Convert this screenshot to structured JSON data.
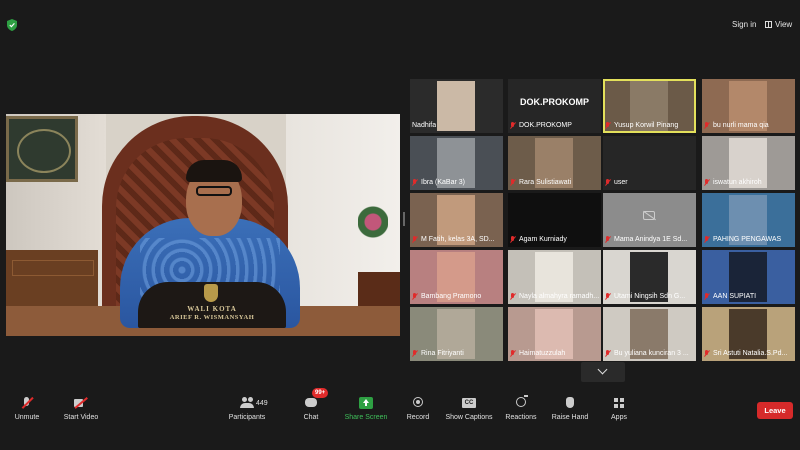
{
  "top": {
    "sign_in": "Sign in",
    "view": "View"
  },
  "speaker": {
    "nameplate_line1": "WALI KOTA",
    "nameplate_line2": "ARIEF R. WISMANSYAH"
  },
  "gallery": [
    {
      "label": "Nadhifa",
      "muted": false,
      "active": false,
      "bg": "#2b2b2b",
      "thumb": "#cbb9a6"
    },
    {
      "label": "DOK.PROKOMP",
      "muted": true,
      "active": false,
      "bg": "#262626",
      "title": "DOK.PROKOMP"
    },
    {
      "label": "Yusup Korwil Pinang",
      "muted": true,
      "active": true,
      "bg": "#6b5a48",
      "thumb": "#8a7a66"
    },
    {
      "label": "bu nurli mama qia",
      "muted": true,
      "active": false,
      "bg": "#8e6a52",
      "thumb": "#b3886a"
    },
    {
      "label": "Ibra (KaBar 3)",
      "muted": true,
      "active": false,
      "bg": "#4a4f55",
      "thumb": "#8e9296"
    },
    {
      "label": "Rara Sulistiawati",
      "muted": true,
      "active": false,
      "bg": "#6d5c4a",
      "thumb": "#9a8068"
    },
    {
      "label": "user",
      "muted": true,
      "active": false,
      "bg": "#262626"
    },
    {
      "label": "iswatun akhiroh",
      "muted": true,
      "active": false,
      "bg": "#9e9a96",
      "thumb": "#d8d2cc"
    },
    {
      "label": "M Fatih, kelas 3A, SD...",
      "muted": true,
      "active": false,
      "bg": "#7a6250",
      "thumb": "#c19a7c"
    },
    {
      "label": "Agam Kurniady",
      "muted": true,
      "active": false,
      "bg": "#0f0f0f"
    },
    {
      "label": "Mama Anindya 1E Sd...",
      "muted": true,
      "active": false,
      "bg": "#8c8c8c",
      "camoff": true
    },
    {
      "label": "PAHING PENGAWAS",
      "muted": true,
      "active": false,
      "bg": "#3b6f9a",
      "thumb": "#6d8fb0"
    },
    {
      "label": "Bambang Pramono",
      "muted": true,
      "active": false,
      "bg": "#b88080",
      "thumb": "#d49a8a"
    },
    {
      "label": "Nayla almahyra ramadh...",
      "muted": true,
      "active": false,
      "bg": "#c4c0b8",
      "thumb": "#e8e4dc"
    },
    {
      "label": "Utami Ningsih Sdn G...",
      "muted": true,
      "active": false,
      "bg": "#d9d6d0",
      "thumb": "#2a2a2a"
    },
    {
      "label": "AAN SUPIATI",
      "muted": true,
      "active": false,
      "bg": "#3a5fa0",
      "thumb": "#1a2438"
    },
    {
      "label": "Rina Fitriyanti",
      "muted": true,
      "active": false,
      "bg": "#8a8a7a",
      "thumb": "#b0a898"
    },
    {
      "label": "Haimatuzzulah",
      "muted": true,
      "active": false,
      "bg": "#b89a90",
      "thumb": "#dcbab0"
    },
    {
      "label": "Bu yuliana kunciran 3 ...",
      "muted": true,
      "active": false,
      "bg": "#cfcac2",
      "thumb": "#8a7a6a"
    },
    {
      "label": "Sri Astuti Natalia.S.Pd...",
      "muted": true,
      "active": false,
      "bg": "#b9a27a",
      "thumb": "#4a3a2a"
    }
  ],
  "toolbar": {
    "unmute": "Unmute",
    "start_video": "Start Video",
    "participants": "Participants",
    "participants_count": "449",
    "chat": "Chat",
    "chat_badge": "99+",
    "share_screen": "Share Screen",
    "record": "Record",
    "show_captions": "Show Captions",
    "reactions": "Reactions",
    "raise_hand": "Raise Hand",
    "apps": "Apps",
    "leave": "Leave"
  },
  "colors": {
    "background": "#1a1a1a",
    "active_speaker": "#e3e05b",
    "muted_icon": "#e02b2b",
    "share_green": "#2ea043",
    "leave_red": "#d62a2a"
  }
}
